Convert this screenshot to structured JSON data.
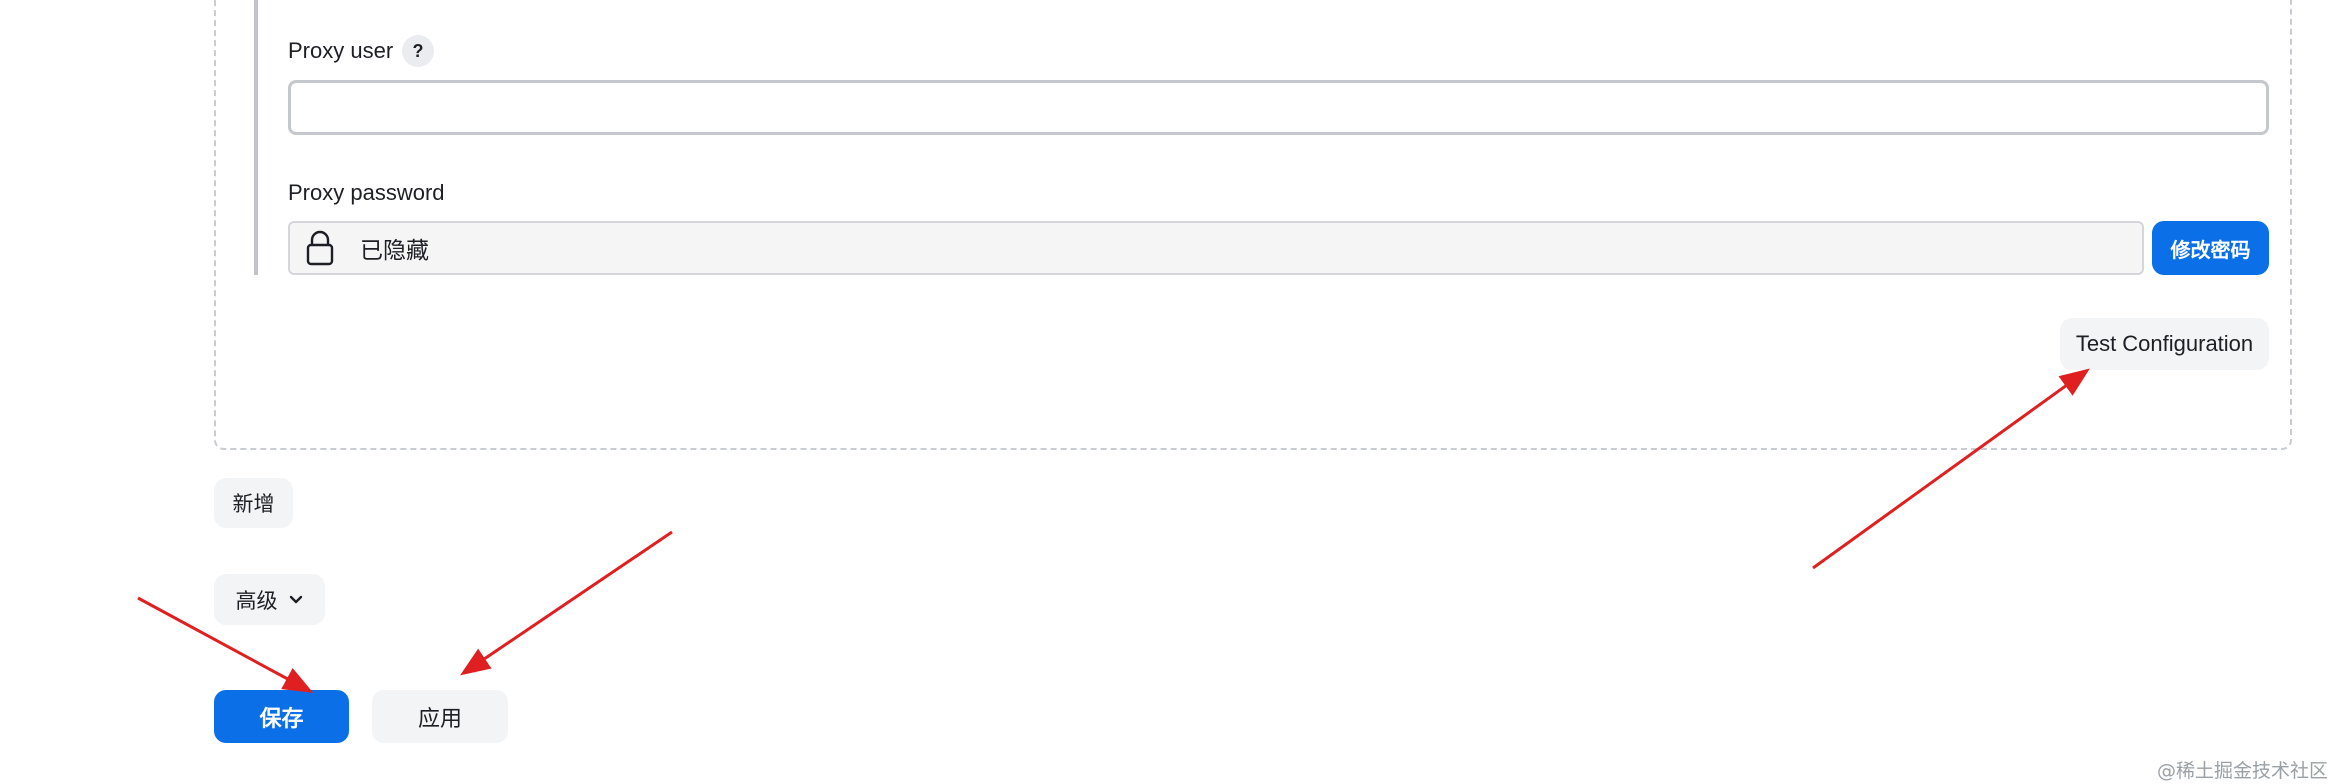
{
  "proxy": {
    "user_label": "Proxy user",
    "help_badge": "?",
    "user_value": "",
    "password_label": "Proxy password",
    "password_status": "已隐藏",
    "change_password_label": "修改密码",
    "lock_icon": "lock-icon"
  },
  "actions": {
    "test_configuration_label": "Test Configuration",
    "add_label": "新增",
    "advanced_label": "高级",
    "chevron_icon": "chevron-down-icon",
    "save_label": "保存",
    "apply_label": "应用"
  },
  "watermark": "@稀土掘金技术社区",
  "colors": {
    "primary": "#0b6fe8",
    "annotation_arrow": "#e02020",
    "light_button": "#f3f4f6"
  }
}
